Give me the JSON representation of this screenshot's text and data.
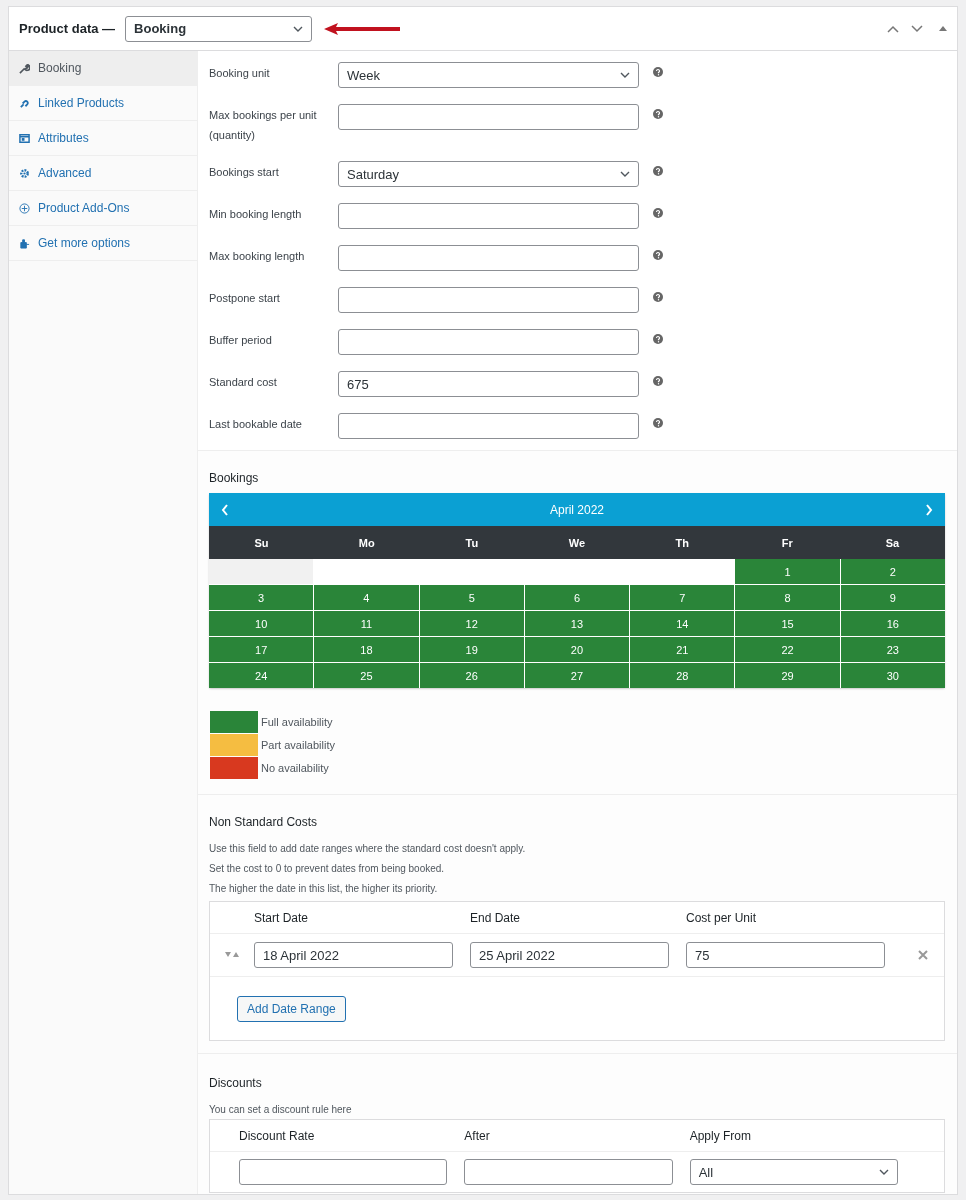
{
  "header": {
    "title": "Product data —",
    "product_type": "Booking"
  },
  "sidebar": {
    "items": [
      {
        "label": "Booking",
        "selected": true
      },
      {
        "label": "Linked Products",
        "selected": false
      },
      {
        "label": "Attributes",
        "selected": false
      },
      {
        "label": "Advanced",
        "selected": false
      },
      {
        "label": "Product Add-Ons",
        "selected": false
      },
      {
        "label": "Get more options",
        "selected": false
      }
    ]
  },
  "fields": [
    {
      "label": "Booking unit",
      "kind": "select",
      "value": "Week"
    },
    {
      "label": "Max bookings per unit (quantity)",
      "kind": "input"
    },
    {
      "label": "Bookings start",
      "kind": "select",
      "value": "Saturday"
    },
    {
      "label": "Min booking length",
      "kind": "input"
    },
    {
      "label": "Max booking length",
      "kind": "input"
    },
    {
      "label": "Postpone start",
      "kind": "input"
    },
    {
      "label": "Buffer period",
      "kind": "input"
    },
    {
      "label": "Standard cost",
      "kind": "input",
      "value": "675"
    },
    {
      "label": "Last bookable date",
      "kind": "input"
    }
  ],
  "bookings": {
    "title": "Bookings",
    "month": "April 2022",
    "weekdays": [
      "Su",
      "Mo",
      "Tu",
      "We",
      "Th",
      "Fr",
      "Sa"
    ],
    "weeks": [
      [
        {
          "kind": "shaded"
        },
        {
          "kind": "empty"
        },
        {
          "kind": "empty"
        },
        {
          "kind": "empty"
        },
        {
          "kind": "empty"
        },
        {
          "kind": "day",
          "day": "1",
          "color": "#2a8539"
        },
        {
          "kind": "day",
          "day": "2",
          "color": "#2a8539"
        }
      ],
      [
        {
          "kind": "day",
          "day": "3",
          "color": "#2a8539"
        },
        {
          "kind": "day",
          "day": "4",
          "color": "#2a8539"
        },
        {
          "kind": "day",
          "day": "5",
          "color": "#2a8539"
        },
        {
          "kind": "day",
          "day": "6",
          "color": "#2a8539"
        },
        {
          "kind": "day",
          "day": "7",
          "color": "#2a8539"
        },
        {
          "kind": "day",
          "day": "8",
          "color": "#2a8539"
        },
        {
          "kind": "day",
          "day": "9",
          "color": "#2a8539"
        }
      ],
      [
        {
          "kind": "day",
          "day": "10",
          "color": "#2a8539"
        },
        {
          "kind": "day",
          "day": "11",
          "color": "#2a8539"
        },
        {
          "kind": "day",
          "day": "12",
          "color": "#2a8539"
        },
        {
          "kind": "day",
          "day": "13",
          "color": "#2a8539"
        },
        {
          "kind": "day",
          "day": "14",
          "color": "#2a8539"
        },
        {
          "kind": "day",
          "day": "15",
          "color": "#2a8539"
        },
        {
          "kind": "day",
          "day": "16",
          "color": "#2a8539"
        }
      ],
      [
        {
          "kind": "day",
          "day": "17",
          "color": "#2a8539"
        },
        {
          "kind": "day",
          "day": "18",
          "color": "#2a8539"
        },
        {
          "kind": "day",
          "day": "19",
          "color": "#2a8539"
        },
        {
          "kind": "day",
          "day": "20",
          "color": "#2a8539"
        },
        {
          "kind": "day",
          "day": "21",
          "color": "#2a8539"
        },
        {
          "kind": "day",
          "day": "22",
          "color": "#2a8539"
        },
        {
          "kind": "day",
          "day": "23",
          "color": "#2a8539"
        }
      ],
      [
        {
          "kind": "day",
          "day": "24",
          "color": "#2a8539"
        },
        {
          "kind": "day",
          "day": "25",
          "color": "#2a8539"
        },
        {
          "kind": "day",
          "day": "26",
          "color": "#2a8539"
        },
        {
          "kind": "day",
          "day": "27",
          "color": "#2a8539"
        },
        {
          "kind": "day",
          "day": "28",
          "color": "#2a8539"
        },
        {
          "kind": "day",
          "day": "29",
          "color": "#2a8539"
        },
        {
          "kind": "day",
          "day": "30",
          "color": "#2a8539"
        }
      ]
    ],
    "legend": [
      {
        "label": "Full availability",
        "color": "#2a8539"
      },
      {
        "label": "Part availability",
        "color": "#f5bd41"
      },
      {
        "label": "No availability",
        "color": "#d8391f"
      }
    ]
  },
  "non_standard_costs": {
    "title": "Non Standard Costs",
    "notes": [
      "Use this field to add date ranges where the standard cost doesn't apply.",
      "Set the cost to 0 to prevent dates from being booked.",
      "The higher the date in this list, the higher its priority."
    ],
    "columns": [
      "Start Date",
      "End Date",
      "Cost per Unit"
    ],
    "rows": [
      [
        "18 April 2022",
        "25 April 2022",
        "75"
      ]
    ],
    "add_button": "Add Date Range"
  },
  "discounts": {
    "title": "Discounts",
    "note": "You can set a discount rule here",
    "columns": [
      "Discount Rate",
      "After",
      "Apply From"
    ],
    "apply_from": "All"
  }
}
